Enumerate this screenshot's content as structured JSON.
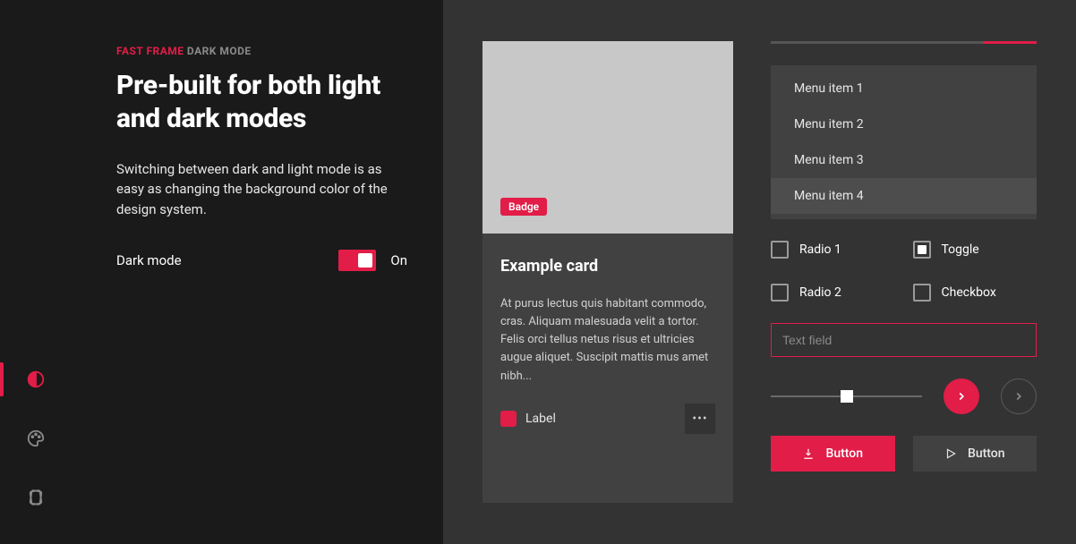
{
  "nav": {
    "items": [
      {
        "name": "contrast-icon",
        "active": true
      },
      {
        "name": "palette-icon",
        "active": false
      },
      {
        "name": "cards-icon",
        "active": false
      }
    ]
  },
  "left": {
    "eyebrow_pink": "FAST FRAME",
    "eyebrow_grey": "DARK MODE",
    "heading": "Pre-built for both light and dark modes",
    "subtext": "Switching between dark and light mode is as easy as changing the background color of the design system.",
    "toggle_label": "Dark mode",
    "toggle_state": "On"
  },
  "card": {
    "badge": "Badge",
    "title": "Example card",
    "desc": "At purus lectus quis habitant commodo, cras. Aliquam malesuada velit a tortor. Felis orci tellus netus risus et ultricies augue aliquet. Suscipit mattis mus amet nibh...",
    "label": "Label"
  },
  "menu": {
    "items": [
      "Menu item 1",
      "Menu item 2",
      "Menu item 3",
      "Menu item 4"
    ]
  },
  "form": {
    "radio1": "Radio 1",
    "radio2": "Radio 2",
    "toggle": "Toggle",
    "checkbox": "Checkbox",
    "text_placeholder": "Text field"
  },
  "buttons": {
    "primary": "Button",
    "secondary": "Button"
  },
  "colors": {
    "accent": "#e11d48",
    "surface_dark": "#1a1a1a",
    "surface_panel": "#333333",
    "surface_raised": "#414141"
  }
}
